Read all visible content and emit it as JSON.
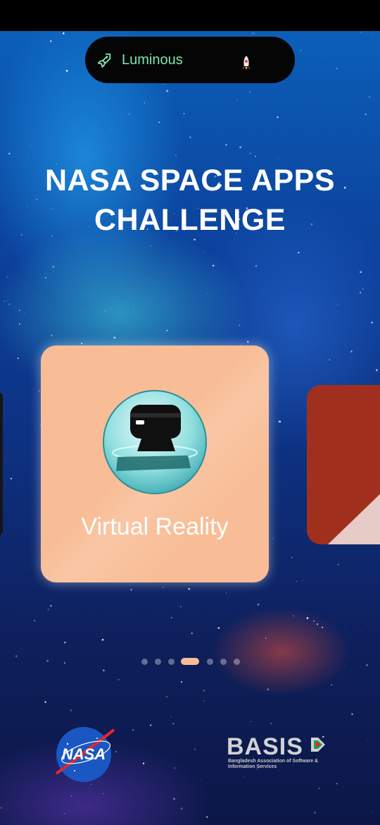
{
  "status_bar": {},
  "notification_pill": {
    "label": "Luminous",
    "icon": "rocket-icon",
    "accent_color": "#7fe6b0"
  },
  "headline": {
    "line1": "NASA SPACE APPS",
    "line2": "CHALLENGE"
  },
  "carousel": {
    "current_card": {
      "label": "Virtual Reality",
      "icon": "vr-headset-icon",
      "color": "#f8bd96"
    },
    "next_card_color": "#a0301d",
    "previous_card_color": "#161616",
    "page_count": 7,
    "active_page": 4
  },
  "footer": {
    "nasa_logo_text": "NASA",
    "basis_logo_text": "BASIS",
    "basis_subtitle": "Bangladesh Association of Software & Information Services"
  }
}
